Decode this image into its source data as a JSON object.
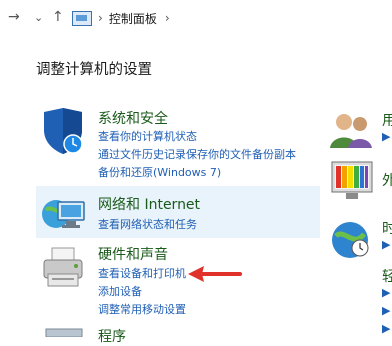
{
  "nav": {
    "back_glyph": "→",
    "history_glyph": "⌄",
    "up_glyph": "↑",
    "crumb_sep": "›",
    "breadcrumb": "控制面板",
    "breadcrumb_sep2": "›"
  },
  "page": {
    "heading": "调整计算机的设置"
  },
  "categories": [
    {
      "title": "系统和安全",
      "icon": "shield-icon",
      "links": [
        "查看你的计算机状态",
        "通过文件历史记录保存你的文件备份副本",
        "备份和还原(Windows 7)"
      ]
    },
    {
      "title": "网络和 Internet",
      "icon": "network-globe-icon",
      "links": [
        "查看网络状态和任务"
      ]
    },
    {
      "title": "硬件和声音",
      "icon": "printer-icon",
      "links": [
        "查看设备和打印机",
        "添加设备",
        "调整常用移动设置"
      ]
    },
    {
      "title": "程序",
      "icon": "programs-icon",
      "links": []
    }
  ],
  "right_column": {
    "users_title": "用",
    "users_icon": "user-accounts-icon",
    "appearance_title": "外",
    "appearance_icon": "appearance-monitor-icon",
    "clock_title": "时",
    "clock_icon": "clock-globe-icon",
    "access_title": "轻",
    "links": [
      "▶",
      "▶",
      "▶",
      "▶",
      "▶"
    ]
  },
  "colors": {
    "accent_link": "#1f5fb4",
    "category_title": "#1a5a1a",
    "hover_bg": "#e9f3fb",
    "arrow": "#e0322b"
  }
}
